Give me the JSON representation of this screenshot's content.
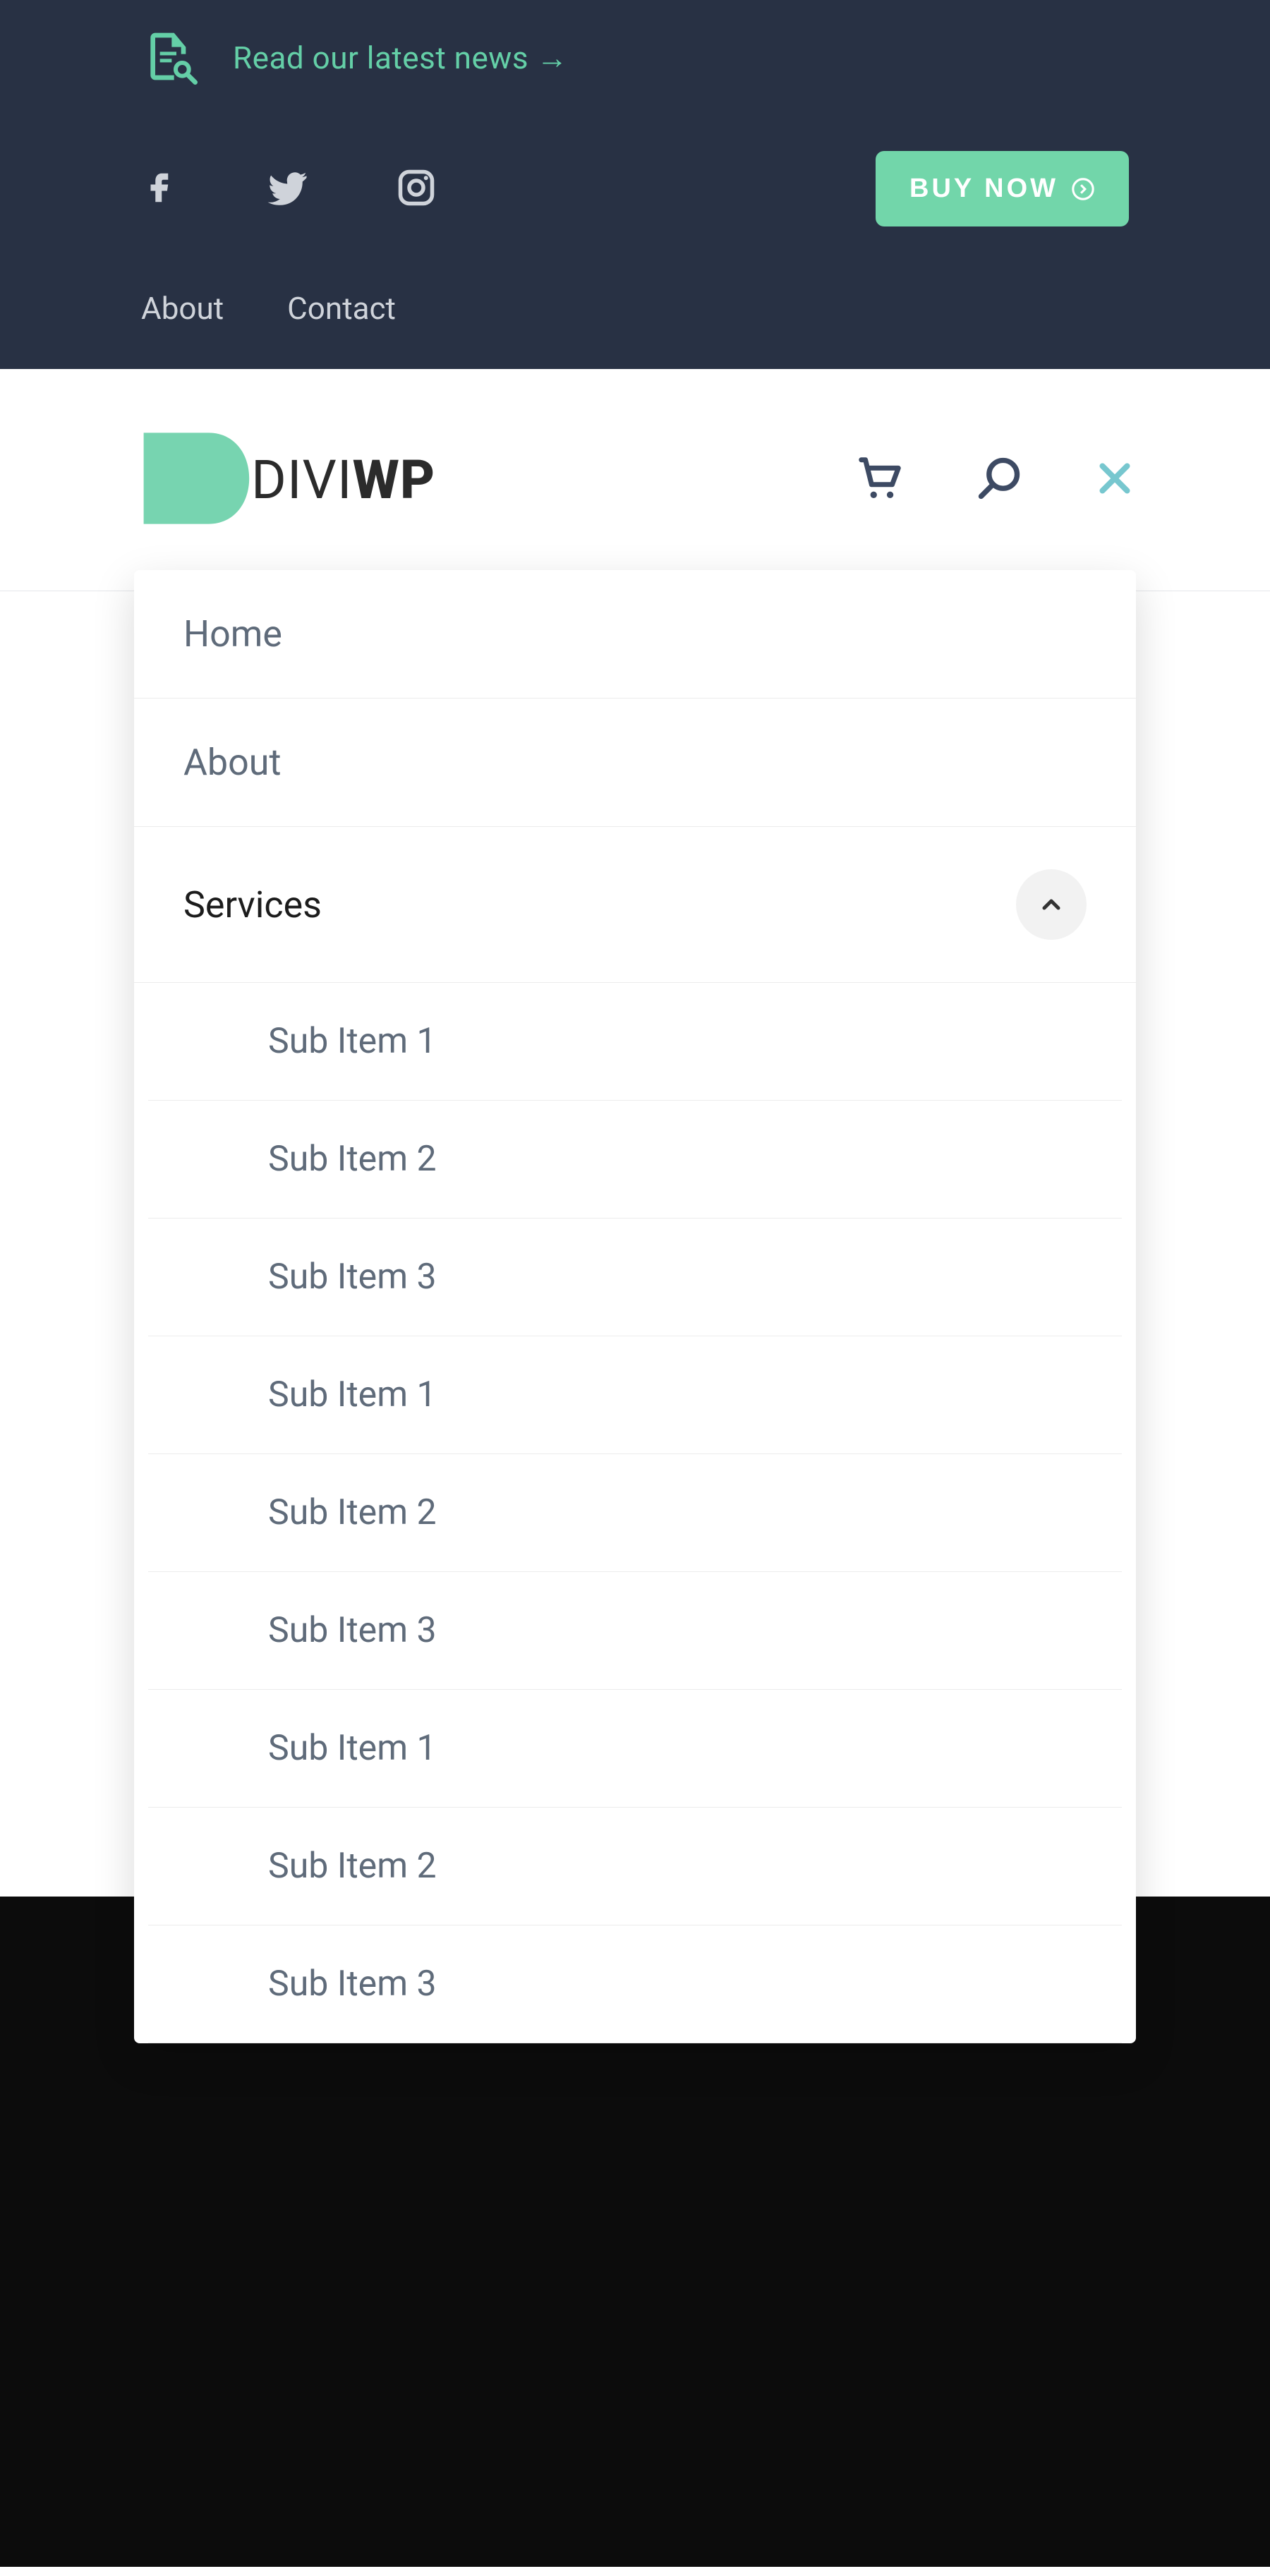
{
  "topbar": {
    "news_label": "Read our latest news →",
    "buy_label": "BUY NOW",
    "links": {
      "about": "About",
      "contact": "Contact"
    }
  },
  "logo": {
    "text_regular": "DIVI",
    "text_bold": "WP"
  },
  "menu": {
    "items": [
      {
        "label": "Home"
      },
      {
        "label": "About"
      },
      {
        "label": "Services",
        "expanded": true
      }
    ],
    "sub_items": [
      "Sub Item 1",
      "Sub Item 2",
      "Sub Item 3",
      "Sub Item 1",
      "Sub Item 2",
      "Sub Item 3",
      "Sub Item 1",
      "Sub Item 2",
      "Sub Item 3"
    ]
  },
  "colors": {
    "accent": "#77d4b0",
    "topbar_bg": "#283144",
    "text_muted": "#5f6b7a"
  }
}
